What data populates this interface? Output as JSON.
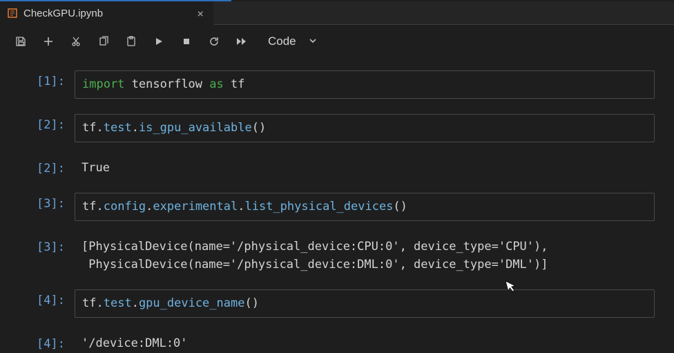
{
  "tab": {
    "icon_name": "notebook-icon",
    "label": "CheckGPU.ipynb",
    "close_label": "×"
  },
  "toolbar": {
    "celltype_label": "Code"
  },
  "cells": [
    {
      "prompt": "[1]:",
      "lines": [
        {
          "segments": [
            {
              "t": "import",
              "cls": "tk-kw"
            },
            {
              "t": " ",
              "cls": "tk-plain"
            },
            {
              "t": "tensorflow",
              "cls": "tk-mod"
            },
            {
              "t": " ",
              "cls": "tk-plain"
            },
            {
              "t": "as",
              "cls": "tk-kw"
            },
            {
              "t": " ",
              "cls": "tk-plain"
            },
            {
              "t": "tf",
              "cls": "tk-mod"
            }
          ]
        }
      ],
      "kind": "input"
    },
    {
      "prompt": "[2]:",
      "lines": [
        {
          "segments": [
            {
              "t": "tf",
              "cls": "tk-mod"
            },
            {
              "t": ".",
              "cls": "tk-plain"
            },
            {
              "t": "test",
              "cls": "tk-attr"
            },
            {
              "t": ".",
              "cls": "tk-plain"
            },
            {
              "t": "is_gpu_available",
              "cls": "tk-func"
            },
            {
              "t": "()",
              "cls": "tk-plain"
            }
          ]
        }
      ],
      "kind": "input"
    },
    {
      "prompt": "[2]:",
      "lines": [
        {
          "segments": [
            {
              "t": "True",
              "cls": "tk-plain"
            }
          ]
        }
      ],
      "kind": "output"
    },
    {
      "prompt": "[3]:",
      "lines": [
        {
          "segments": [
            {
              "t": "tf",
              "cls": "tk-mod"
            },
            {
              "t": ".",
              "cls": "tk-plain"
            },
            {
              "t": "config",
              "cls": "tk-attr"
            },
            {
              "t": ".",
              "cls": "tk-plain"
            },
            {
              "t": "experimental",
              "cls": "tk-attr"
            },
            {
              "t": ".",
              "cls": "tk-plain"
            },
            {
              "t": "list_physical_devices",
              "cls": "tk-func"
            },
            {
              "t": "()",
              "cls": "tk-plain"
            }
          ]
        }
      ],
      "kind": "input"
    },
    {
      "prompt": "[3]:",
      "lines": [
        {
          "segments": [
            {
              "t": "[PhysicalDevice(name='/physical_device:CPU:0', device_type='CPU'),",
              "cls": "tk-plain"
            }
          ]
        },
        {
          "segments": [
            {
              "t": " PhysicalDevice(name='/physical_device:DML:0', device_type='DML')]",
              "cls": "tk-plain"
            }
          ]
        }
      ],
      "kind": "output"
    },
    {
      "prompt": "[4]:",
      "lines": [
        {
          "segments": [
            {
              "t": "tf",
              "cls": "tk-mod"
            },
            {
              "t": ".",
              "cls": "tk-plain"
            },
            {
              "t": "test",
              "cls": "tk-attr"
            },
            {
              "t": ".",
              "cls": "tk-plain"
            },
            {
              "t": "gpu_device_name",
              "cls": "tk-func"
            },
            {
              "t": "()",
              "cls": "tk-plain"
            }
          ]
        }
      ],
      "kind": "input"
    },
    {
      "prompt": "[4]:",
      "lines": [
        {
          "segments": [
            {
              "t": "'/device:DML:0'",
              "cls": "tk-plain"
            }
          ]
        }
      ],
      "kind": "output"
    }
  ]
}
